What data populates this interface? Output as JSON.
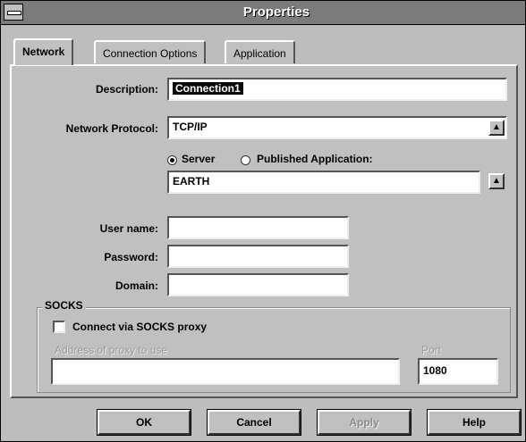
{
  "window": {
    "title": "Properties"
  },
  "tabs": [
    {
      "label": "Network"
    },
    {
      "label": "Connection Options"
    },
    {
      "label": "Application"
    }
  ],
  "network": {
    "description_label": "Description:",
    "description_value": "Connection1",
    "protocol_label": "Network Protocol:",
    "protocol_value": "TCP/IP",
    "server_radio": "Server",
    "published_radio": "Published Application:",
    "server_value": "EARTH",
    "username_label": "User name:",
    "username_value": "",
    "password_label": "Password:",
    "password_value": "",
    "domain_label": "Domain:",
    "domain_value": ""
  },
  "socks": {
    "group_label": "SOCKS",
    "checkbox_label": "Connect via SOCKS proxy",
    "address_label": "Address of proxy to use",
    "address_value": "",
    "port_label": "Port",
    "port_value": "1080"
  },
  "buttons": {
    "ok": "OK",
    "cancel": "Cancel",
    "apply": "Apply",
    "help": "Help"
  }
}
